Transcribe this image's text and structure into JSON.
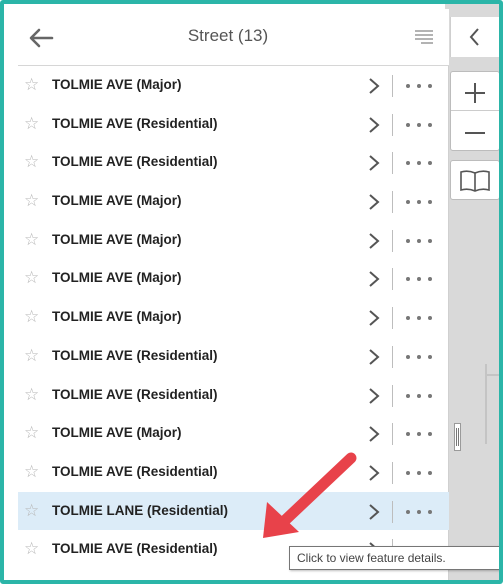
{
  "header": {
    "title": "Street (13)",
    "back_icon": "arrow-left-icon",
    "list_icon": "list-lines-icon"
  },
  "rows": [
    {
      "label": "TOLMIE AVE (Major)",
      "selected": false
    },
    {
      "label": "TOLMIE AVE (Residential)",
      "selected": false
    },
    {
      "label": "TOLMIE AVE (Residential)",
      "selected": false
    },
    {
      "label": "TOLMIE AVE (Major)",
      "selected": false
    },
    {
      "label": "TOLMIE AVE (Major)",
      "selected": false
    },
    {
      "label": "TOLMIE AVE (Major)",
      "selected": false
    },
    {
      "label": "TOLMIE AVE (Major)",
      "selected": false
    },
    {
      "label": "TOLMIE AVE (Residential)",
      "selected": false
    },
    {
      "label": "TOLMIE AVE (Residential)",
      "selected": false
    },
    {
      "label": "TOLMIE AVE (Major)",
      "selected": false
    },
    {
      "label": "TOLMIE AVE (Residential)",
      "selected": false
    },
    {
      "label": "TOLMIE LANE (Residential)",
      "selected": true
    },
    {
      "label": "TOLMIE AVE (Residential)",
      "selected": false
    }
  ],
  "map_controls": {
    "collapse_icon": "chevron-left-icon",
    "zoom_in_icon": "plus-icon",
    "zoom_out_icon": "minus-icon",
    "bookmarks_icon": "open-book-icon"
  },
  "tooltip": {
    "text": "Click to view feature details."
  },
  "colors": {
    "frame": "#2bb5a8",
    "selected_row": "#dcecf8",
    "arrow": "#e8424a"
  }
}
